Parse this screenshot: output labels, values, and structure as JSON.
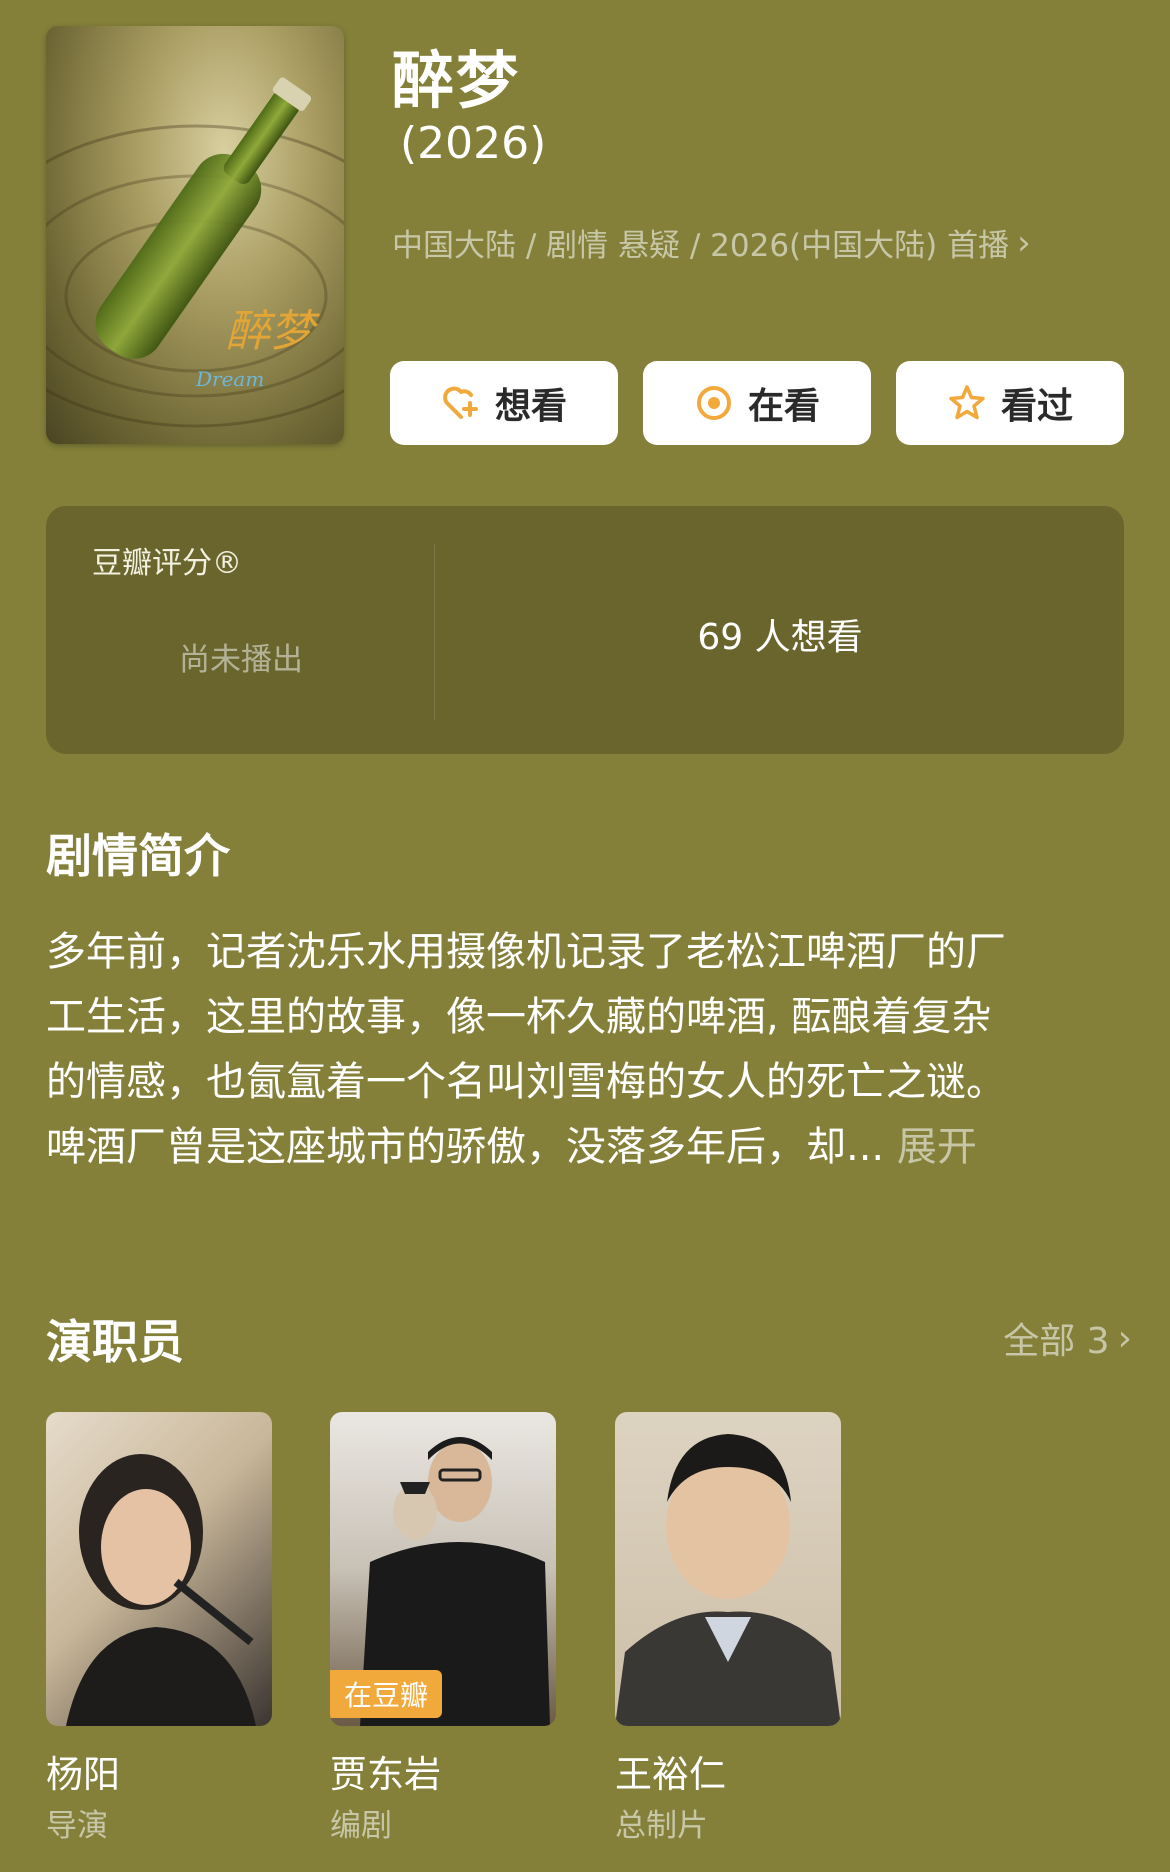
{
  "header": {
    "title": "醉梦",
    "year": "(2026)",
    "meta": "中国大陆 / 剧情 悬疑 / 2026(中国大陆) 首播",
    "poster_alt_title": "醉梦",
    "poster_alt_en": "Dream"
  },
  "actions": [
    {
      "label": "想看",
      "icon": "heart-plus-icon"
    },
    {
      "label": "在看",
      "icon": "target-icon"
    },
    {
      "label": "看过",
      "icon": "star-icon"
    }
  ],
  "rating": {
    "label": "豆瓣评分®",
    "status": "尚未播出",
    "want_count": "69 人想看"
  },
  "synopsis": {
    "heading": "剧情简介",
    "lines": [
      "多年前，记者沈乐水用摄像机记录了老松江啤酒厂的厂",
      "工生活，这里的故事，像一杯久藏的啤酒, 酝酿着复杂",
      "的情感，也氤氲着一个名叫刘雪梅的女人的死亡之谜。",
      "啤酒厂曾是这座城市的骄傲，没落多年后，却..."
    ],
    "expand": "展开"
  },
  "cast": {
    "heading": "演职员",
    "all_label": "全部 3",
    "members": [
      {
        "name": "杨阳",
        "role": "导演",
        "tag": ""
      },
      {
        "name": "贾东岩",
        "role": "编剧",
        "tag": "在豆瓣"
      },
      {
        "name": "王裕仁",
        "role": "总制片",
        "tag": ""
      }
    ]
  },
  "colors": {
    "background": "#84803a",
    "rating_panel": "#69652d",
    "accent_orange": "#f2a93b"
  }
}
